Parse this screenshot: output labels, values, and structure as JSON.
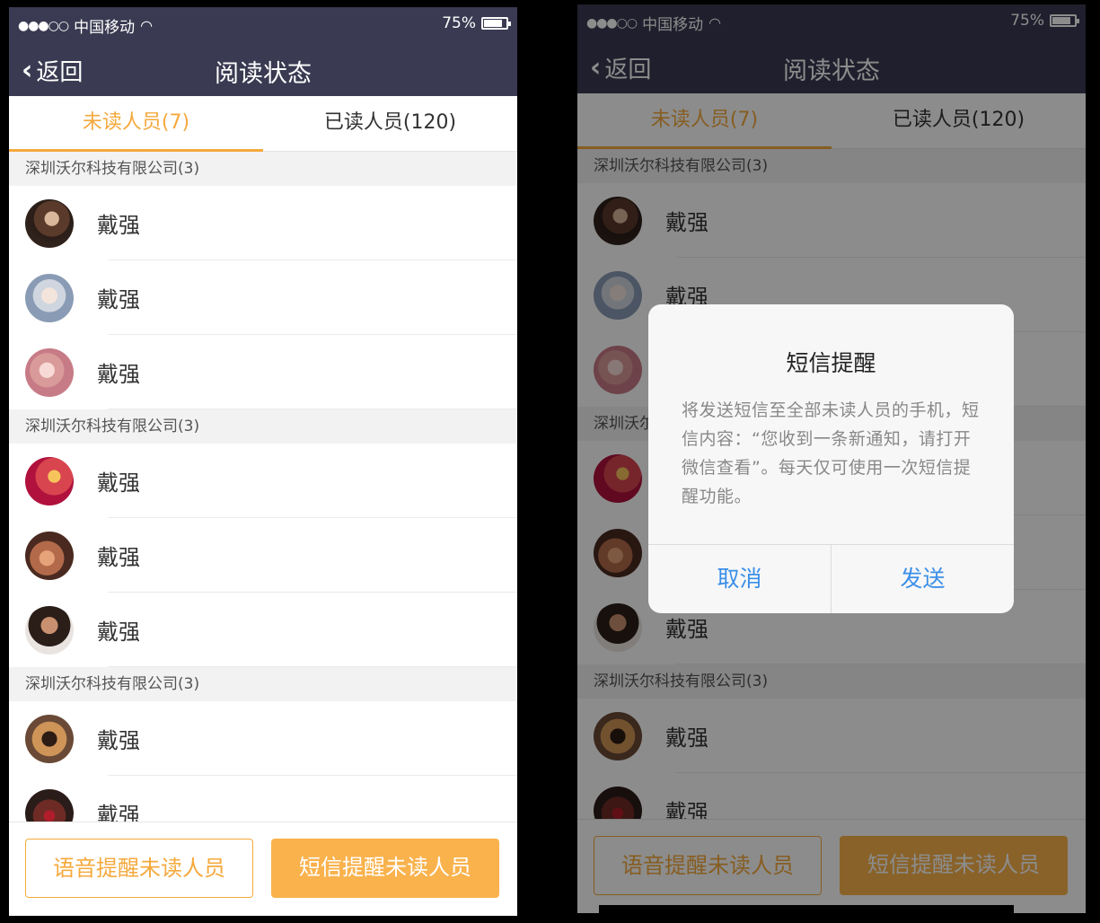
{
  "status": {
    "carrier": "中国移动",
    "battery": "75%",
    "battery_level": 0.75
  },
  "nav": {
    "back_label": "返回",
    "title": "阅读状态"
  },
  "tabs": [
    {
      "label": "未读人员(7)"
    },
    {
      "label": "已读人员(120)"
    }
  ],
  "groups": [
    {
      "header": "深圳沃尔科技有限公司(3)",
      "members": [
        {
          "name": "戴强"
        },
        {
          "name": "戴强"
        },
        {
          "name": "戴强"
        }
      ]
    },
    {
      "header": "深圳沃尔科技有限公司(3)",
      "members": [
        {
          "name": "戴强"
        },
        {
          "name": "戴强"
        },
        {
          "name": "戴强"
        }
      ]
    },
    {
      "header": "深圳沃尔科技有限公司(3)",
      "members": [
        {
          "name": "戴强"
        },
        {
          "name": "戴强"
        }
      ]
    }
  ],
  "actions": {
    "voice_reminder": "语音提醒未读人员",
    "sms_reminder": "短信提醒未读人员"
  },
  "dialog": {
    "title": "短信提醒",
    "message": "将发送短信至全部未读人员的手机，短信内容：“您收到一条新通知，请打开微信查看”。每天仅可使用一次短信提醒功能。",
    "cancel": "取消",
    "send": "发送"
  },
  "colors": {
    "accent": "#f5a93c",
    "navbar": "#3a3a52",
    "link": "#3b8fe8"
  }
}
